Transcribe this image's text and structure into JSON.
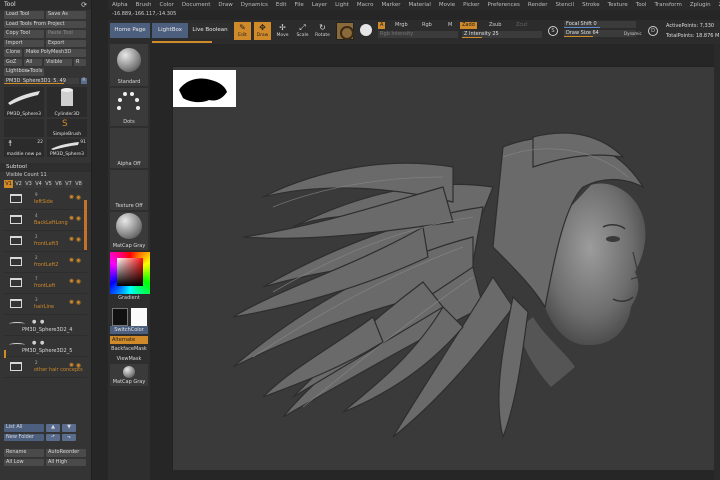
{
  "menu": [
    "Alpha",
    "Brush",
    "Color",
    "Document",
    "Draw",
    "Dynamics",
    "Edit",
    "File",
    "Layer",
    "Light",
    "Macro",
    "Marker",
    "Material",
    "Movie",
    "Picker",
    "Preferences",
    "Render",
    "Stencil",
    "Stroke",
    "Texture",
    "Tool",
    "Transform",
    "Zplugin",
    "Zscript"
  ],
  "coords": "-16.889,-166.117,-14.305",
  "tool": {
    "title": "Tool",
    "buttons": {
      "load_tool": "Load Tool",
      "save_as": "Save As",
      "load_from_project": "Load Tools From Project",
      "copy_tool": "Copy Tool",
      "paste_tool": "Paste Tool",
      "import": "Import",
      "export": "Export",
      "clone": "Clone",
      "make_polymesh": "Make PolyMesh3D",
      "goz": "GoZ",
      "all": "All",
      "visible": "Visible",
      "r": "R"
    },
    "lightbox_tools": "Lightbox▸Tools",
    "current_tool": "PM3D_Sphere3D1_5. 49",
    "current_tool_num": "R",
    "thumbs": [
      {
        "name": "PM3D_Sphere3",
        "count": ""
      },
      {
        "name": "Cylinder3D",
        "count": ""
      },
      {
        "name": "",
        "count": ""
      },
      {
        "name": "SimpleBrush",
        "count": ""
      },
      {
        "name": "maddie new po",
        "count": "22"
      },
      {
        "name": "PM3D_Sphere3",
        "count": "91"
      }
    ]
  },
  "subtool": {
    "header": "Subtool",
    "visible_count": "Visible Count 11",
    "versions": [
      "V1",
      "V2",
      "V3",
      "V4",
      "V5",
      "V6",
      "V7",
      "V8"
    ],
    "items": [
      {
        "label": "leftSide",
        "count": "9",
        "type": "folder"
      },
      {
        "label": "BackLeftLong",
        "count": "4",
        "type": "folder"
      },
      {
        "label": "frontLeft3",
        "count": "2",
        "type": "folder"
      },
      {
        "label": "frontLeft2",
        "count": "2",
        "type": "folder"
      },
      {
        "label": "frontLeft",
        "count": "7",
        "type": "folder"
      },
      {
        "label": "hairLine",
        "count": "3",
        "type": "folder"
      },
      {
        "label": "PM3D_Sphere3D2_4",
        "count": "",
        "type": "mesh"
      },
      {
        "label": "PM3D_Sphere3D2_5",
        "count": "",
        "type": "mesh"
      },
      {
        "label": "other hair concepts",
        "count": "2",
        "type": "folder"
      }
    ],
    "bottom": {
      "list_all": "List All",
      "new_folder": "New Folder",
      "rename": "Rename",
      "autoreorder": "AutoReorder",
      "all_low": "All Low",
      "all_high": "All High"
    }
  },
  "shelf": {
    "home_page": "Home Page",
    "lightbox": "LightBox",
    "live_boolean": "Live Boolean",
    "edit": "Edit",
    "draw": "Draw",
    "move": "Move",
    "scale": "Scale",
    "rotate": "Rotate",
    "a": "A",
    "mrgb": "Mrgb",
    "rgb": "Rgb",
    "m": "M",
    "zadd": "Zadd",
    "zsub": "Zsub",
    "zcut": "Zcut",
    "rgb_intensity": "Rgb Intensity",
    "z_intensity": "Z Intensity 25",
    "focal_shift": "Focal Shift 0",
    "draw_size": "Draw Size 64",
    "dynamic": "Dynamic",
    "active_points": "ActivePoints: 7,330",
    "total_points": "TotalPoints: 18.876 M"
  },
  "tray": {
    "standard": "Standard",
    "dots": "Dots",
    "alpha_off": "Alpha Off",
    "texture_off": "Texture Off",
    "matcap_gray": "MatCap Gray",
    "gradient": "Gradient",
    "switch_color": "SwitchColor",
    "alternate": "Alternate",
    "backface_mask": "BackfaceMask",
    "view_mask": "ViewMask",
    "matcap_gray2": "MatCap Gray"
  },
  "colors": {
    "accent": "#d08a2a",
    "blue": "#4d5f7f",
    "panel": "#343434",
    "canvas": "#3a3a3a"
  },
  "icons": [
    "gear-icon",
    "folder-icon",
    "eye-icon",
    "paint-icon",
    "arrow-up-icon",
    "arrow-down-icon",
    "edit-icon",
    "draw-icon",
    "move-icon",
    "scale-icon",
    "rotate-icon"
  ]
}
